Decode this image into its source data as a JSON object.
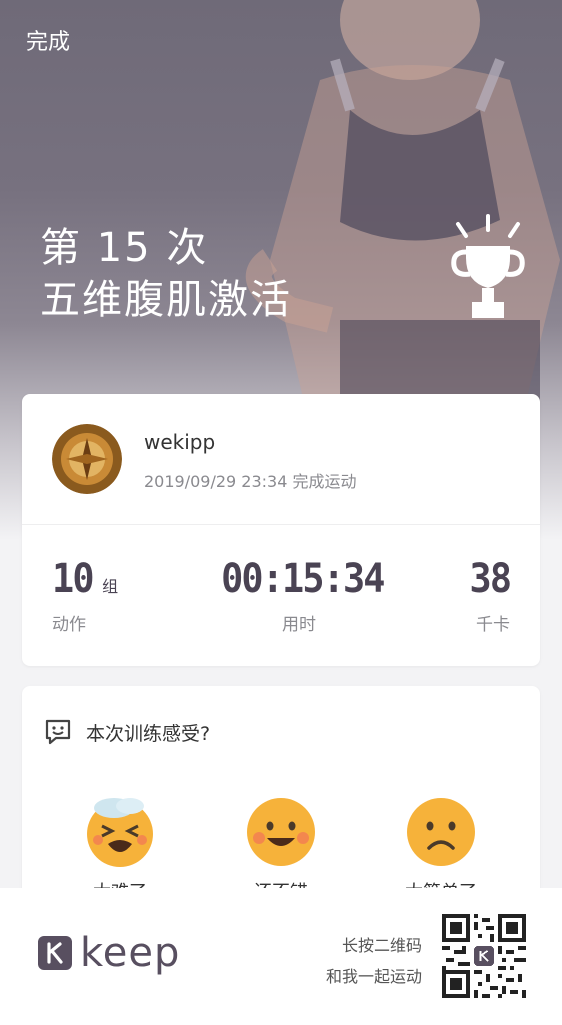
{
  "header": {
    "done_label": "完成"
  },
  "hero": {
    "title_line1": "第 15 次",
    "title_line2": "五维腹肌激活"
  },
  "summary": {
    "username": "wekipp",
    "completed_text": "2019/09/29 23:34 完成运动",
    "stats": [
      {
        "value": "10",
        "unit": "组",
        "label": "动作"
      },
      {
        "value": "00:15:34",
        "label": "用时"
      },
      {
        "value": "38",
        "label": "千卡"
      }
    ]
  },
  "feeling": {
    "question": "本次训练感受?",
    "options": [
      {
        "icon": "exhausted-emoji-icon",
        "label": "太难了"
      },
      {
        "icon": "happy-emoji-icon",
        "label": "还不错"
      },
      {
        "icon": "sad-emoji-icon",
        "label": "太简单了"
      }
    ]
  },
  "footer": {
    "brand": "keep",
    "slogan_line1": "长按二维码",
    "slogan_line2": "和我一起运动"
  },
  "colors": {
    "brand": "#584f60",
    "emoji": "#f5a623"
  }
}
